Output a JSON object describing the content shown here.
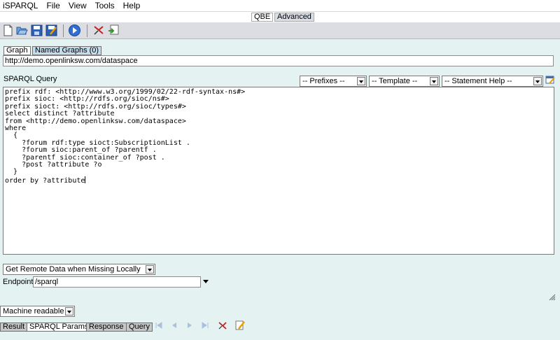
{
  "menu": [
    "iSPARQL",
    "File",
    "View",
    "Tools",
    "Help"
  ],
  "modes": {
    "qbe": "QBE",
    "advanced": "Advanced"
  },
  "toolbar_icons": [
    "new-document-icon",
    "open-folder-icon",
    "save-icon",
    "save-as-icon",
    "run-query-icon",
    "clear-icon",
    "import-icon"
  ],
  "graph_tabs": {
    "graph": "Graph",
    "named_graphs": "Named Graphs (0)"
  },
  "graph_uri": "http://demo.openlinksw.com/dataspace",
  "query_label": "SPARQL Query",
  "dropdowns": {
    "prefixes": "-- Prefixes --",
    "template": "-- Template --",
    "statement_help": "-- Statement Help --"
  },
  "query_lines": [
    "prefix rdf: <http://www.w3.org/1999/02/22-rdf-syntax-ns#>",
    "prefix sioc: <http://rdfs.org/sioc/ns#>",
    "prefix sioct: <http://rdfs.org/sioc/types#>",
    "select distinct ?attribute",
    "from <http://demo.openlinksw.com/dataspace>",
    "where",
    "  {",
    "    ?forum rdf:type sioct:SubscriptionList .",
    "    ?forum sioc:parent_of ?parentf .",
    "    ?parentf sioc:container_of ?post .",
    "    ?post ?attribute ?o",
    "  }",
    "order by ?attribute"
  ],
  "remote_data_option": "Get Remote Data when Missing Locally",
  "endpoint": {
    "label": "Endpoint",
    "value": "/sparql"
  },
  "output_format": "Machine readable",
  "bottom_tabs": [
    "Result",
    "SPARQL Params",
    "Response",
    "Query"
  ]
}
